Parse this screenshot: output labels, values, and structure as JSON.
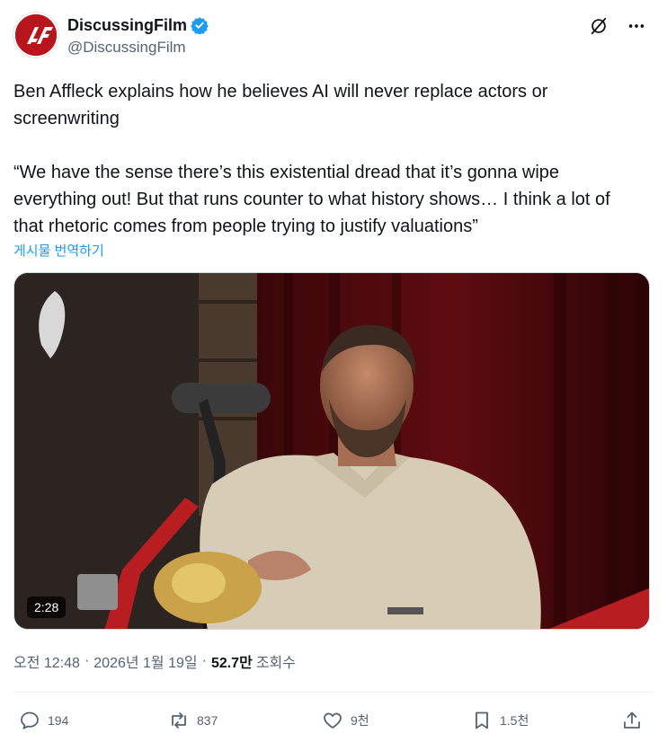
{
  "account": {
    "display_name": "DiscussingFilm",
    "handle": "@DiscussingFilm",
    "verified": true,
    "avatar_icon": "discussingfilm-logo",
    "avatar_color": "#b8161d"
  },
  "header_icons": [
    "grok-icon",
    "more-icon"
  ],
  "post": {
    "text": "Ben Affleck explains how he believes AI will never replace actors or screenwriting\n\n“We have the sense there’s this existential dread that it’s gonna wipe everything out! But that runs counter to what history shows… I think a lot of that rhetoric comes from people trying to justify valuations”",
    "translate_label": "게시물 번역하기"
  },
  "media": {
    "type": "video",
    "duration": "2:28"
  },
  "meta": {
    "time": "오전 12:48",
    "separator": "·",
    "date": "2026년 1월 19일",
    "views_count": "52.7만",
    "views_label": "조회수"
  },
  "actions": {
    "replies": "194",
    "reposts": "837",
    "likes": "9천",
    "bookmarks": "1.5천"
  },
  "colors": {
    "accent": "#1d9bf0",
    "text_primary": "#0f1419",
    "text_secondary": "#536471"
  }
}
